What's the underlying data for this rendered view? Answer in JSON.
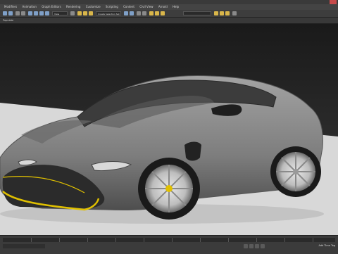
{
  "app": {
    "title": ""
  },
  "menu": {
    "items": [
      "Modifiers",
      "Animation",
      "Graph Editors",
      "Rendering",
      "Customize",
      "Scripting",
      "Content",
      "Civil View",
      "Arnold",
      "Help"
    ]
  },
  "toolbar": {
    "view_combo": "View",
    "selection_set_combo": "Create Selection Set"
  },
  "toolbar2": {
    "label": "Populate"
  },
  "status": {
    "text": "Add Time Tag"
  },
  "colors": {
    "car_body": "#8a8a8a",
    "accent_yellow": "#e0c000",
    "floor": "#d9d9d9"
  }
}
